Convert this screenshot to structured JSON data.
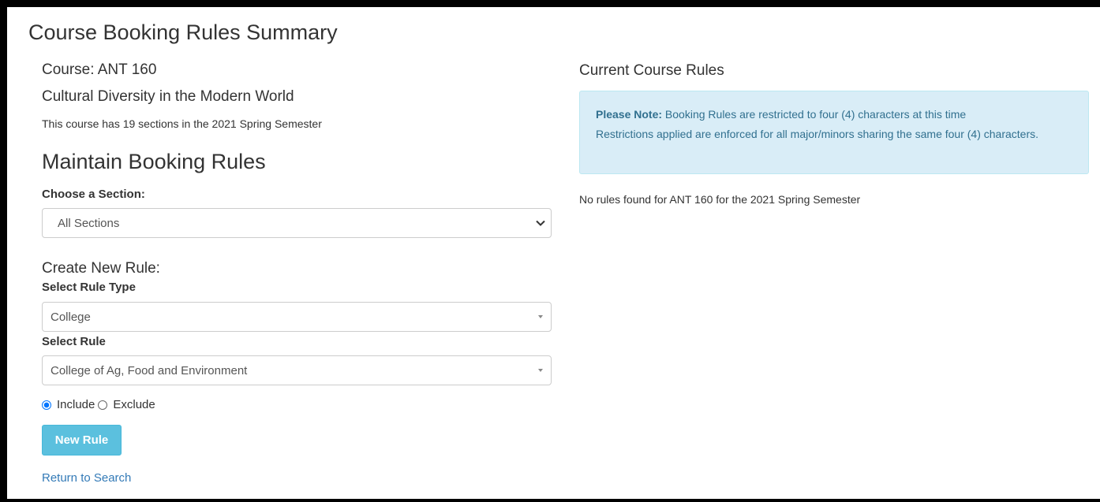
{
  "page": {
    "title": "Course Booking Rules Summary"
  },
  "course": {
    "code_line": "Course: ANT 160",
    "title": "Cultural Diversity in the Modern World",
    "sections_line": "This course has 19 sections in the 2021 Spring Semester"
  },
  "maintain": {
    "heading": "Maintain Booking Rules",
    "section_label": "Choose a Section:",
    "section_value": "All Sections"
  },
  "create": {
    "heading": "Create New Rule:",
    "rule_type_label": "Select Rule Type",
    "rule_type_value": "College",
    "rule_label": "Select Rule",
    "rule_value": "College of Ag, Food and Environment",
    "include_label": "Include",
    "exclude_label": "Exclude",
    "selected_mode": "Include",
    "new_rule_button": "New Rule",
    "return_link": "Return to Search"
  },
  "current": {
    "heading": "Current Course Rules",
    "note_strong": "Please Note:",
    "note_line1": " Booking Rules are restricted to four (4) characters at this time",
    "note_line2": "Restrictions applied are enforced for all major/minors sharing the same four (4) characters.",
    "no_rules": "No rules found for ANT 160 for the 2021 Spring Semester"
  },
  "colors": {
    "info_bg": "#d9edf7",
    "info_text": "#31708f",
    "button_bg": "#5bc0de",
    "link": "#337ab7",
    "radio_accent": "#0075ff"
  }
}
